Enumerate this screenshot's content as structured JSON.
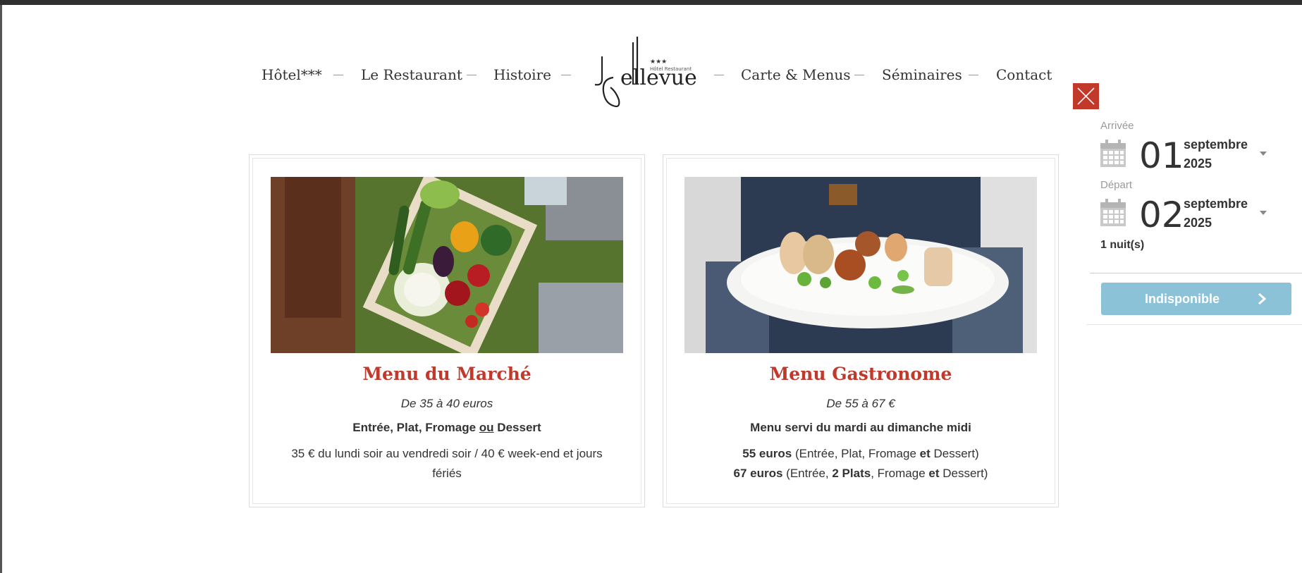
{
  "nav": {
    "left": [
      "Hôtel***",
      "Le Restaurant",
      "Histoire"
    ],
    "right": [
      "Carte & Menus",
      "Séminaires",
      "Contact"
    ]
  },
  "logo": {
    "monogram": "JB",
    "name": "ellevue",
    "stars": "★★★",
    "subtitle": "Hôtel Restaurant"
  },
  "cards": [
    {
      "title": "Menu du Marché",
      "price": "De 35 à 40 euros",
      "courses": {
        "pre": "Entrée, Plat, Fromage ",
        "ou": "ou",
        "post": " Dessert"
      },
      "desc": "35 € du lundi soir au vendredi soir / 40 € week-end et jours fériés",
      "photo": "vegetable-crate-photo"
    },
    {
      "title": "Menu Gastronome",
      "price": "De 55 à 67 €",
      "served": "Menu servi du mardi au dimanche midi",
      "line1": {
        "price": "55 euros",
        "a": " (Entrée, Plat, Fromage ",
        "et": "et",
        "b": " Dessert)"
      },
      "line2": {
        "price": "67 euros",
        "a": " (Entrée, ",
        "plats": "2 Plats",
        "b": ", Fromage ",
        "et": "et",
        "c": " Dessert)"
      },
      "photo": "gastronomic-plate-photo"
    }
  ],
  "booking": {
    "arrival_label": "Arrivée",
    "arrival_day": "01",
    "arrival_month": "septembre",
    "arrival_year": "2025",
    "departure_label": "Départ",
    "departure_day": "02",
    "departure_month": "septembre",
    "departure_year": "2025",
    "nights": "1 nuit(s)",
    "button_label": "Indisponible"
  },
  "colors": {
    "accent": "#c0392b",
    "button": "#8cc2d8",
    "text": "#333333"
  }
}
